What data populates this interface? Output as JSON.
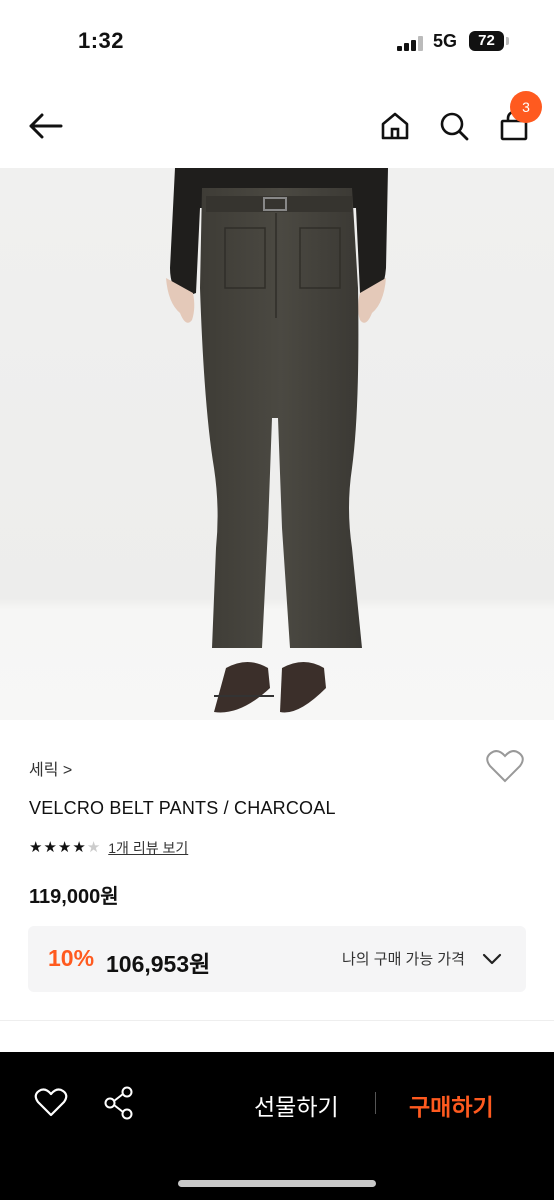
{
  "status_bar": {
    "time": "1:32",
    "network": "5G",
    "battery": "72"
  },
  "nav": {
    "cart_count": "3"
  },
  "product": {
    "brand": "세릭 >",
    "title": "VELCRO BELT PANTS / CHARCOAL",
    "rating_stars": 4,
    "review_link": "1개 리뷰 보기",
    "price": "119,000원",
    "discount_rate": "10%",
    "sale_price": "106,953원",
    "my_price_label": "나의 구매 가능 가격"
  },
  "bottom_bar": {
    "gift_label": "선물하기",
    "buy_label": "구매하기"
  },
  "icons": {
    "back": "arrow-left-icon",
    "home": "home-icon",
    "search": "search-icon",
    "cart": "shopping-bag-icon",
    "wish": "heart-icon",
    "share": "share-icon",
    "expand": "chevron-down-icon"
  },
  "colors": {
    "accent": "#ff5a1f",
    "bottom_bar_bg": "#000000",
    "price_box_bg": "#f5f5f6"
  }
}
